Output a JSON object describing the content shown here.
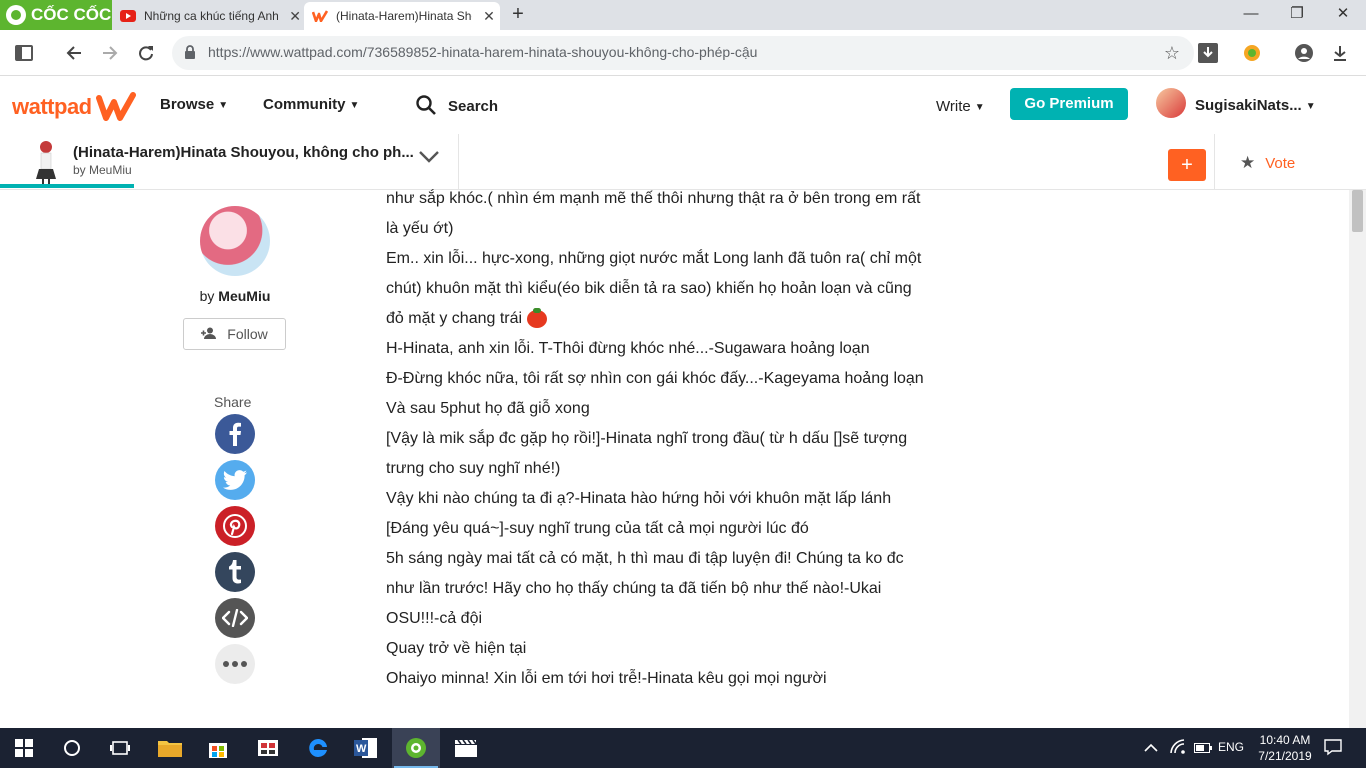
{
  "browser": {
    "brand": "CỐC CỐC",
    "tabs": [
      {
        "title": "Những ca khúc tiếng Anh",
        "close": "✕"
      },
      {
        "title": "(Hinata-Harem)Hinata Shc",
        "close": "✕"
      }
    ],
    "new_tab": "+",
    "url": "https://www.wattpad.com/736589852-hinata-harem-hinata-shouyou-không-cho-phép-cậu"
  },
  "header": {
    "logo": "wattpad",
    "browse": "Browse",
    "community": "Community",
    "search": "Search",
    "write": "Write",
    "premium": "Go Premium",
    "username": "SugisakiNats..."
  },
  "story": {
    "title": "(Hinata-Harem)Hinata Shouyou, không cho ph...",
    "author": "by MeuMiu",
    "add": "+",
    "vote": "Vote",
    "reading_progress": 0.098
  },
  "sidebar": {
    "by": "by",
    "author": "MeuMiu",
    "follow": "Follow",
    "share": "Share",
    "share_buttons": [
      "facebook",
      "twitter",
      "pinterest",
      "tumblr",
      "embed",
      "more"
    ]
  },
  "content": {
    "lines": [
      "như sắp khóc.( nhìn ém mạnh mẽ thế thôi nhưng thật ra ở bên trong em rất là yếu ớt)",
      "Em.. xin lỗi... hực-xong, những giọt nước mắt Long lanh đã tuôn ra( chỉ một chút) khuôn mặt thì kiểu(éo bik diễn tả ra sao) khiến họ hoản loạn và cũng đỏ mặt y chang trái",
      "H-Hinata, anh xin lỗi. T-Thôi đừng khóc nhé...-Sugawara hoảng loạn",
      "Đ-Đừng khóc nữa, tôi rất sợ nhìn con gái khóc đấy...-Kageyama hoảng loạn",
      "Và sau 5phut họ đã giỗ xong",
      "[Vậy là mik sắp đc gặp họ rồi!]-Hinata nghĩ trong đầu( từ h dấu []sẽ tượng trưng cho suy nghĩ nhé!)",
      "Vậy khi nào chúng ta đi ạ?-Hinata hào hứng hỏi với khuôn mặt lấp lánh",
      "[Đáng yêu quá~]-suy nghĩ trung của tất cả mọi người lúc đó",
      "5h sáng ngày mai tất cả có mặt, h thì mau đi tập luyện đi! Chúng ta ko đc như lần trước! Hãy cho họ thấy chúng ta đã tiến bộ như thế nào!-Ukai",
      "OSU!!!-cả đội",
      "Quay trở về hiện tại",
      "Ohaiyo minna! Xin lỗi em tới hơi trễ!-Hinata kêu gọi mọi người"
    ]
  },
  "taskbar": {
    "lang": "ENG",
    "time": "10:40 AM",
    "date": "7/21/2019"
  },
  "colors": {
    "wattpad_orange": "#ff6122",
    "teal": "#00b2b2",
    "coccoc_green": "#5db52f",
    "facebook": "#3b5998",
    "twitter": "#55acee",
    "pinterest": "#cb2027",
    "tumblr": "#34465d",
    "embed": "#555555"
  }
}
